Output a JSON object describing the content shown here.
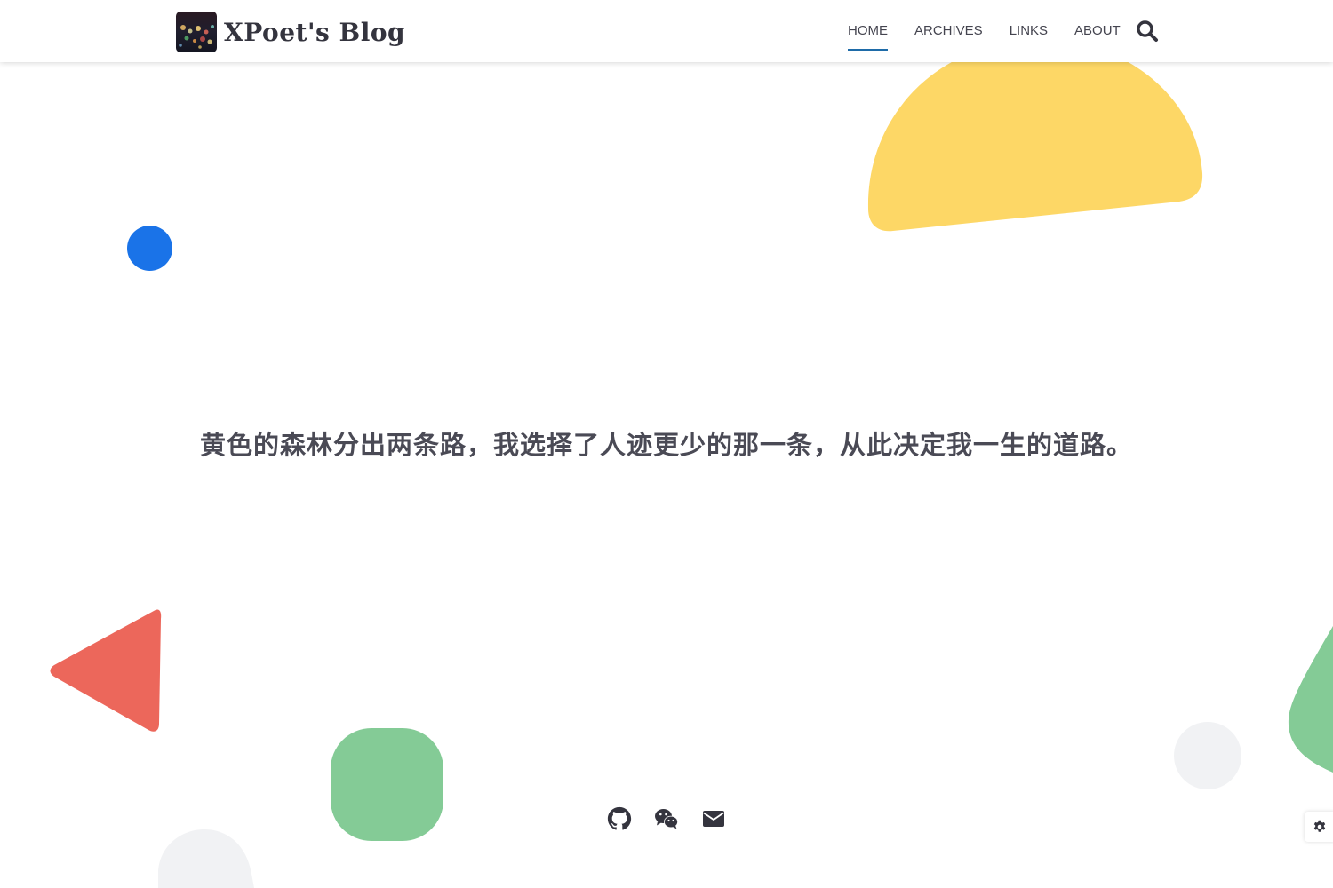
{
  "header": {
    "site_title": "XPoet's Blog",
    "nav": [
      {
        "label": "HOME",
        "active": true
      },
      {
        "label": "ARCHIVES",
        "active": false
      },
      {
        "label": "LINKS",
        "active": false
      },
      {
        "label": "ABOUT",
        "active": false
      }
    ],
    "search_icon": "search-icon"
  },
  "hero": {
    "quote": "黄色的森林分出两条路，我选择了人迹更少的那一条，从此决定我一生的道路。"
  },
  "footer": {
    "socials": [
      {
        "icon": "github-icon"
      },
      {
        "icon": "wechat-icon"
      },
      {
        "icon": "email-icon"
      }
    ]
  },
  "tools": {
    "settings_icon": "gear-icon"
  },
  "colors": {
    "accent": "#1e6ba8",
    "text": "#34343e",
    "yellow_shape": "#fdd766",
    "blue_shape": "#1a73e8",
    "red_shape": "#ec675b",
    "green_shape": "#84cb96",
    "gray_shape": "#f1f2f4"
  }
}
